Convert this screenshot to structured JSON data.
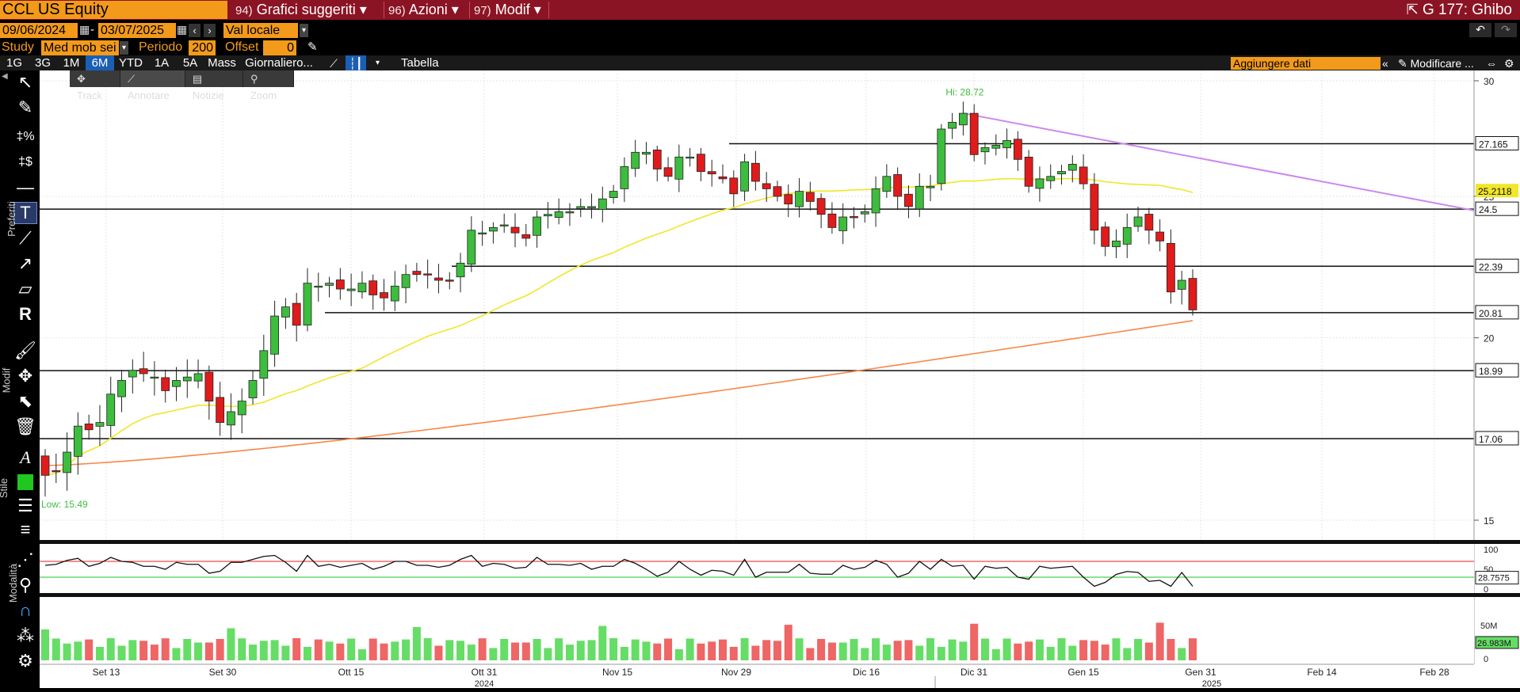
{
  "header": {
    "ticker": "CCL US Equity",
    "menus": [
      {
        "num": "94)",
        "label": "Grafici suggeriti ▾"
      },
      {
        "num": "96)",
        "label": "Azioni ▾"
      },
      {
        "num": "97)",
        "label": "Modif ▾"
      }
    ],
    "graph_label": "G 177: Ghibo"
  },
  "options": {
    "date_start": "09/06/2024",
    "date_end": "03/07/2025",
    "dash": "-",
    "currency": "Val locale",
    "study_label": "Study",
    "study_value": "Med mob sei",
    "period_label": "Periodo",
    "period_value": "200",
    "offset_label": "Offset",
    "offset_value": "0"
  },
  "periods": [
    "1G",
    "3G",
    "1M",
    "6M",
    "YTD",
    "1A",
    "5A",
    "Mass",
    "Giornaliero..."
  ],
  "active_period": "6M",
  "table_label": "Tabella",
  "add_data_placeholder": "Aggiungere dati",
  "modify_label": "Modificare ...",
  "subtools": [
    "Track",
    "Annotare",
    "Notizie",
    "Zoom"
  ],
  "side_labels": {
    "preferiti": "Preferiti",
    "modif": "Modif",
    "stile": "Stile",
    "modalita": "Modalità"
  },
  "icons": [
    "cursor-icon",
    "pen-icon",
    "percent-tool-icon",
    "dollar-tool-icon",
    "horizontal-line-icon",
    "text-icon",
    "trendline-icon",
    "ray-icon",
    "channel-icon",
    "r-icon",
    "brush-icon",
    "move-icon",
    "select-icon",
    "trash-icon",
    "font-icon",
    "color-swatch-icon",
    "line-width-icon",
    "line-style-icon",
    "dotted-line-icon",
    "link-icon",
    "magnet-icon",
    "palette-icon",
    "gear-icon"
  ],
  "colors": {
    "header_bg": "#8b1424",
    "accent_orange": "#f39a1b",
    "up": "#3dbd3d",
    "down": "#e01b1b",
    "ma50": "#f0e62a",
    "ma200": "#f5884a",
    "trend": "#cc88ee"
  },
  "chart_data": {
    "type": "candlestick",
    "price_axis": {
      "min": 15,
      "max": 30,
      "ticks": [
        15,
        20,
        25,
        30
      ]
    },
    "levels": [
      27.165,
      24.5,
      22.39,
      20.81,
      18.99,
      17.06
    ],
    "last_ma": "25.2118",
    "hi_label": "Hi: 28.72",
    "low_label": "Low: 15.49",
    "x_labels": [
      "Set 13",
      "Set 30",
      "Ott 15",
      "Ott 31",
      "Nov 15",
      "Nov 29",
      "Dic 16",
      "Dic 31",
      "Gen 15",
      "Gen 31",
      "Feb 14",
      "Feb 28"
    ],
    "years": [
      "2024",
      "2025"
    ],
    "closes": [
      16.1,
      16.2,
      16.7,
      17.4,
      17.3,
      17.5,
      18.3,
      18.7,
      19.0,
      18.9,
      18.8,
      18.4,
      18.7,
      18.8,
      18.9,
      18.1,
      17.5,
      17.8,
      18.1,
      18.7,
      19.6,
      20.7,
      21.0,
      20.4,
      21.8,
      21.7,
      21.8,
      21.6,
      21.6,
      21.8,
      21.4,
      21.3,
      21.7,
      22.1,
      22.1,
      22.1,
      21.9,
      21.9,
      22.5,
      23.7,
      23.6,
      23.8,
      23.9,
      23.6,
      23.4,
      24.2,
      24.3,
      24.4,
      24.4,
      24.6,
      24.6,
      24.9,
      25.2,
      26.2,
      26.8,
      26.8,
      26.1,
      25.8,
      26.6,
      26.6,
      26.0,
      25.9,
      25.7,
      25.1,
      26.4,
      25.6,
      25.3,
      25.0,
      24.7,
      25.2,
      24.8,
      24.3,
      23.8,
      24.2,
      24.2,
      24.4,
      25.3,
      25.8,
      25.0,
      24.6,
      25.4,
      25.4,
      27.8,
      28.1,
      28.5,
      26.7,
      27.0,
      27.1,
      27.3,
      26.5,
      25.4,
      25.7,
      25.8,
      26.0,
      26.3,
      25.5,
      23.7,
      23.1,
      23.3,
      23.8,
      24.2,
      23.7,
      23.3,
      21.5,
      21.9,
      20.9
    ],
    "rsi_axis": {
      "ticks": [
        0,
        50,
        100
      ]
    },
    "rsi_value": "28.7575",
    "volume_axis": {
      "ticks": [
        "0",
        "50M"
      ]
    },
    "volume_value": "26.983M"
  }
}
